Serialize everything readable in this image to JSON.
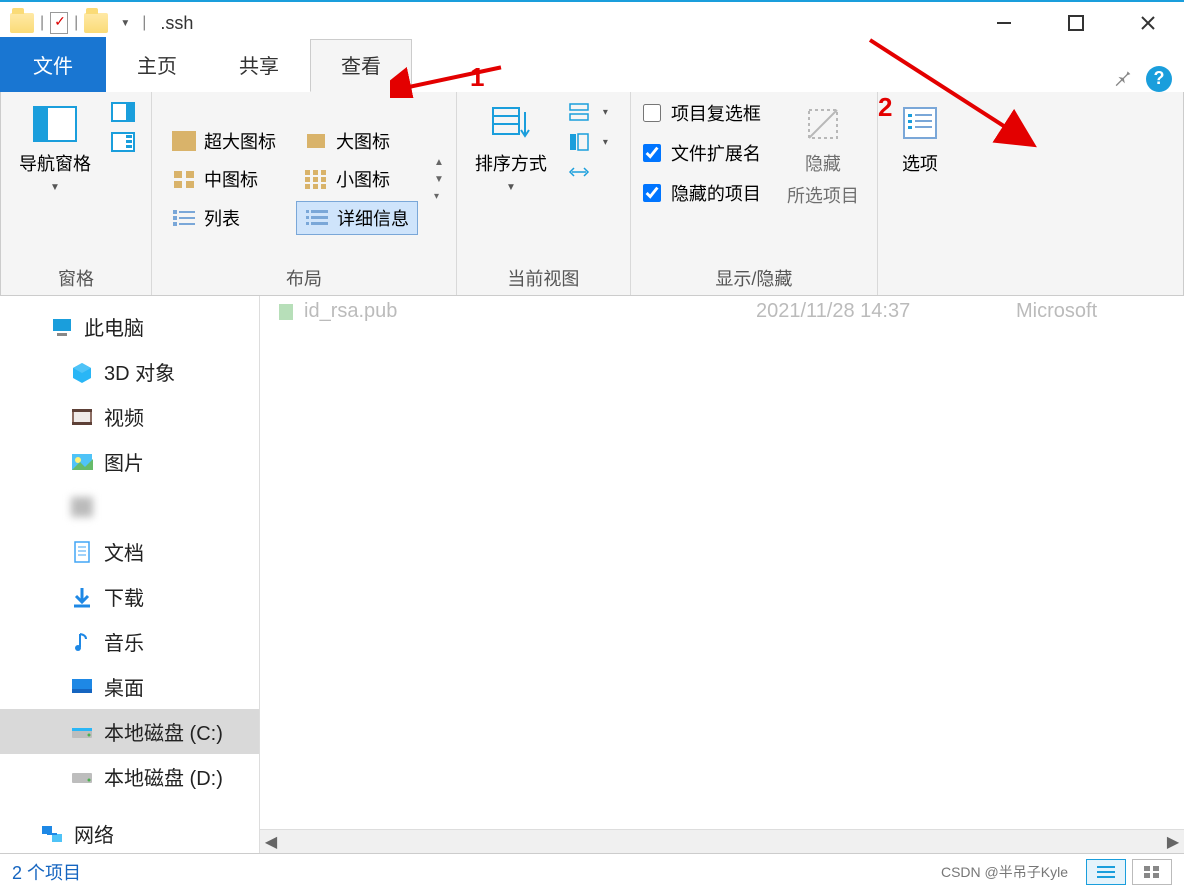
{
  "window": {
    "title": ".ssh"
  },
  "tabs": {
    "file": "文件",
    "home": "主页",
    "share": "共享",
    "view": "查看"
  },
  "ribbon": {
    "panes_group": "窗格",
    "nav_pane": "导航窗格",
    "layout_group": "布局",
    "layout": {
      "xl": "超大图标",
      "large": "大图标",
      "medium": "中图标",
      "small": "小图标",
      "list": "列表",
      "details": "详细信息"
    },
    "view_group": "当前视图",
    "sort": "排序方式",
    "showhide_group": "显示/隐藏",
    "checkboxes": "项目复选框",
    "extensions": "文件扩展名",
    "hidden_items": "隐藏的项目",
    "hide": "隐藏",
    "hide_sub": "所选项目",
    "options": "选项"
  },
  "annotations": {
    "a1": "1",
    "a2": "2"
  },
  "sidebar": {
    "this_pc": "此电脑",
    "objects3d": "3D 对象",
    "videos": "视频",
    "pictures": "图片",
    "redacted": "　　　　",
    "documents": "文档",
    "downloads": "下载",
    "music": "音乐",
    "desktop": "桌面",
    "disk_c": "本地磁盘 (C:)",
    "disk_d": "本地磁盘 (D:)",
    "network": "网络"
  },
  "files": {
    "row0": {
      "name": "id_rsa.pub",
      "date": "2021/11/28 14:37",
      "type": "Microsoft"
    }
  },
  "status": {
    "count": "2 个项目",
    "watermark": "CSDN @半吊子Kyle"
  }
}
